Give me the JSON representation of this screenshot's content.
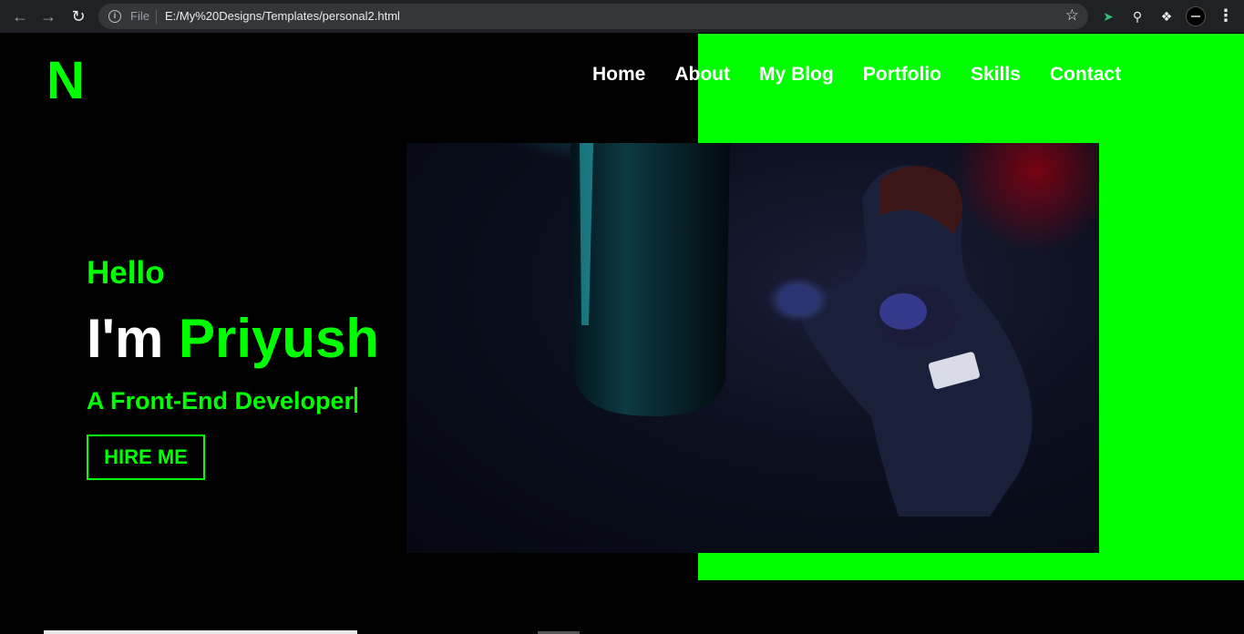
{
  "browser": {
    "back_icon": "arrow-left-icon",
    "forward_icon": "arrow-right-icon",
    "reload_icon": "reload-icon",
    "file_label": "File",
    "url": "E:/My%20Designs/Templates/personal2.html",
    "bookmark_icon": "star-icon",
    "extension_icons": [
      "extension-cursor-icon",
      "extension-search-icon",
      "puzzle-icon"
    ],
    "menu_icon": "kebab-menu-icon"
  },
  "site": {
    "logo": "N",
    "nav": [
      "Home",
      "About",
      "My Blog",
      "Portfolio",
      "Skills",
      "Contact"
    ],
    "hero": {
      "greeting": "Hello",
      "intro_prefix": "I'm",
      "name": "Priyush",
      "role": "A Front-End Developer",
      "cta": "HIRE ME"
    }
  },
  "colors": {
    "accent": "#00ff00",
    "background": "#000000",
    "text": "#ffffff"
  }
}
